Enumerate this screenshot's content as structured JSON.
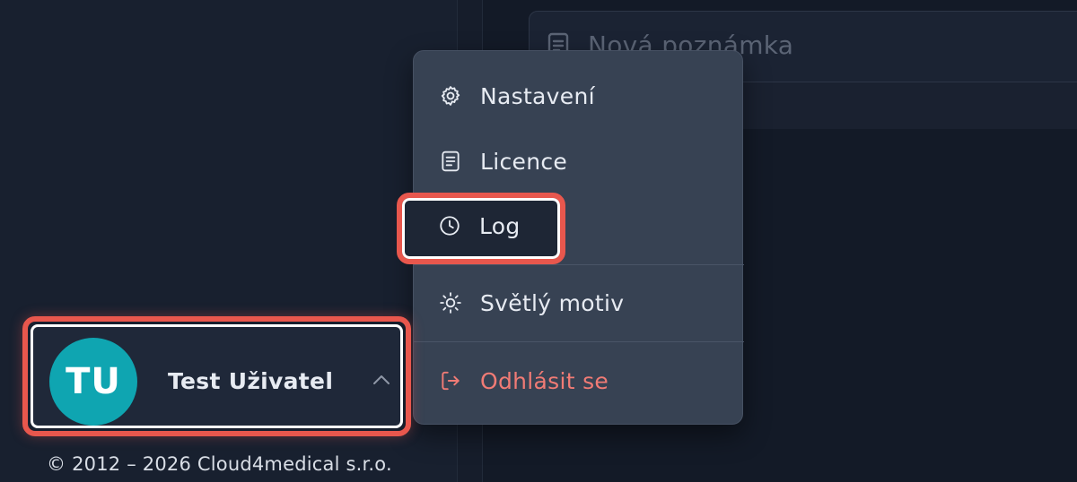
{
  "note": {
    "placeholder_title": "Nová poznámka",
    "icon": "document-icon"
  },
  "menu": {
    "items": [
      {
        "label": "Nastavení",
        "icon": "gear-icon"
      },
      {
        "label": "Licence",
        "icon": "document-icon"
      },
      {
        "label": "Log",
        "icon": "clock-icon"
      },
      {
        "label": "Světlý motiv",
        "icon": "sun-icon"
      },
      {
        "label": "Odhlásit se",
        "icon": "logout-icon"
      }
    ]
  },
  "user": {
    "initials": "TU",
    "name": "Test Uživatel",
    "expand_icon": "chevron-up-icon"
  },
  "footer": {
    "copyright": "© 2012 – 2026 Cloud4medical s.r.o."
  },
  "colors": {
    "accent_teal": "#0fa5b1",
    "danger": "#f07b75",
    "highlight": "#e8574d"
  }
}
